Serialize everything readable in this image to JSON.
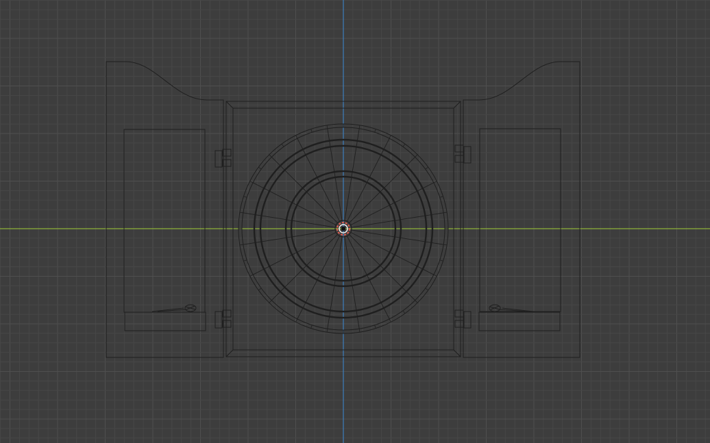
{
  "viewport": {
    "view_mode": "wireframe",
    "orthographic_view": "front",
    "colors": {
      "background": "#3d3d3d",
      "grid_minor": "#474747",
      "grid_major": "#4f4f4f",
      "x_axis": "#8fb23a",
      "z_axis": "#3d7fbf",
      "wire": "#1f1f1f",
      "origin_outer": "#e05d4f",
      "origin_inner": "#111111"
    },
    "scene": {
      "object": "dartboard-cabinet",
      "dartboard_segments": 20,
      "doors": [
        "left-door",
        "right-door"
      ],
      "hinges_per_door": 2,
      "darts_per_door": 1
    }
  }
}
